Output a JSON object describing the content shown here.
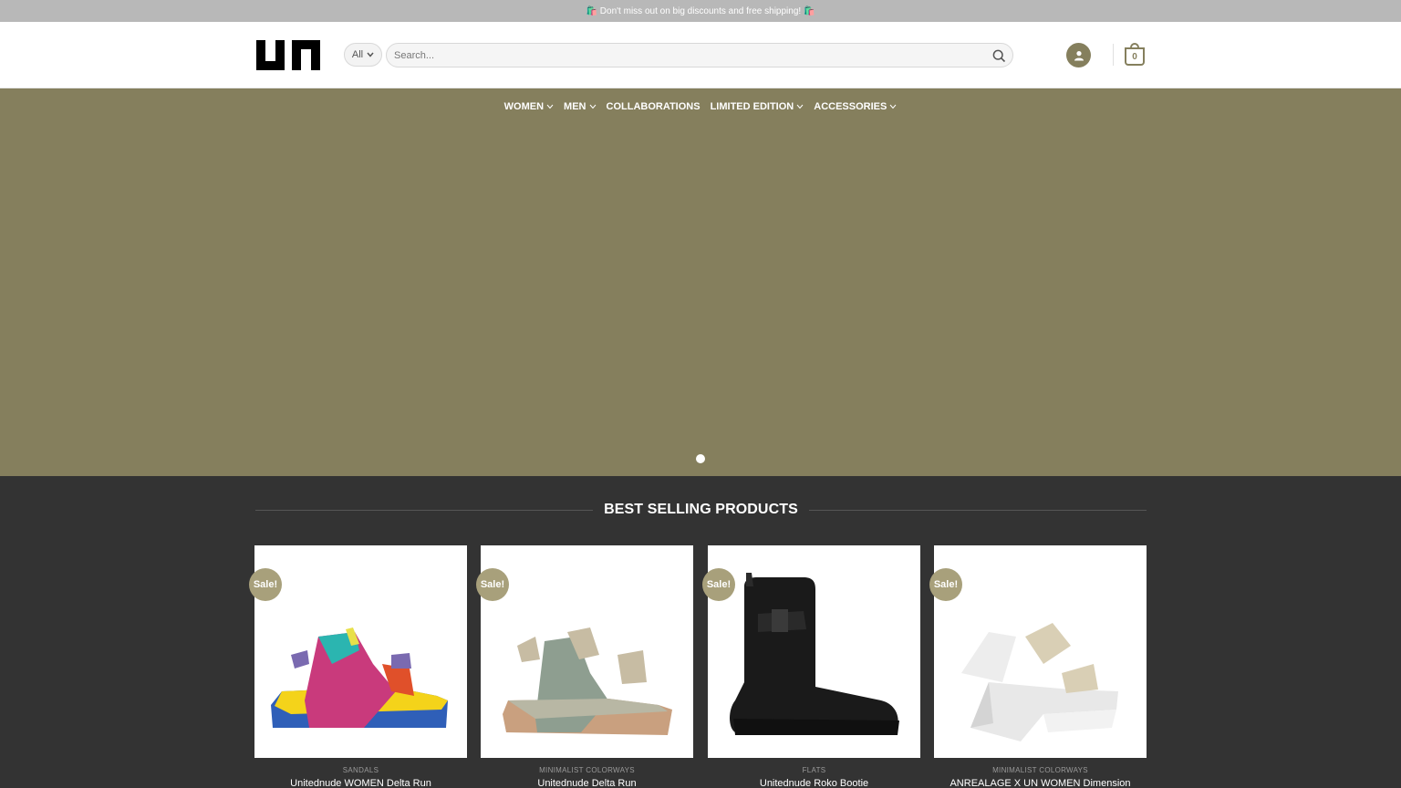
{
  "promo_bar": {
    "text": "🛍️ Don't miss out on big discounts and free shipping! 🛍️"
  },
  "header": {
    "logo_text": "UN",
    "category_select": {
      "selected": "All"
    },
    "search": {
      "placeholder": "Search...",
      "value": ""
    },
    "cart_count": "0"
  },
  "nav": {
    "items": [
      {
        "label": "WOMEN",
        "has_dropdown": true
      },
      {
        "label": "MEN",
        "has_dropdown": true
      },
      {
        "label": "COLLABORATIONS",
        "has_dropdown": false
      },
      {
        "label": "LIMITED EDITION",
        "has_dropdown": true
      },
      {
        "label": "ACCESSORIES",
        "has_dropdown": true
      }
    ]
  },
  "hero": {
    "background": "#857f5d",
    "slide_count": 1,
    "active_slide": 1
  },
  "best_selling": {
    "title": "BEST SELLING PRODUCTS",
    "products": [
      {
        "badge": "Sale!",
        "category": "SANDALS",
        "name": "Unitednude WOMEN Delta Run"
      },
      {
        "badge": "Sale!",
        "category": "MINIMALIST COLORWAYS",
        "name": "Unitednude Delta Run"
      },
      {
        "badge": "Sale!",
        "category": "FLATS",
        "name": "Unitednude Roko Bootie"
      },
      {
        "badge": "Sale!",
        "category": "MINIMALIST COLORWAYS",
        "name": "ANREALAGE X UN WOMEN Dimension"
      }
    ]
  },
  "colors": {
    "accent": "#857f5d",
    "badge": "#a8a07b",
    "dark_bg": "#333333",
    "promo_bg": "#b8b8b8"
  }
}
